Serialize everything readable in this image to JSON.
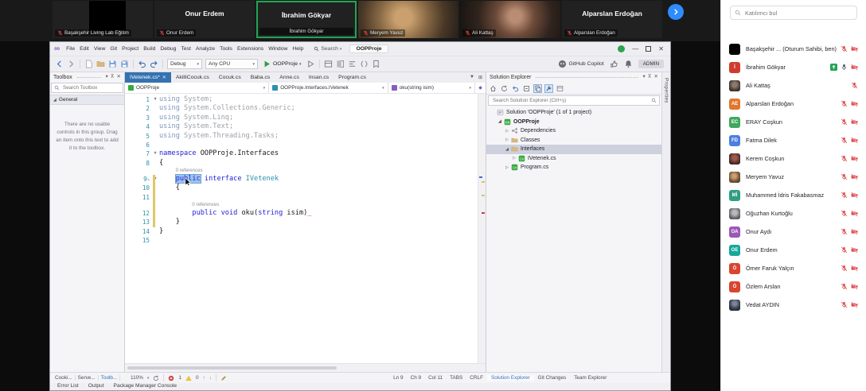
{
  "colors": {
    "accent_blue": "#3572b0",
    "zoom_blue": "#2e8cff",
    "active_speaker_green": "#23a455",
    "danger_red": "#e04444",
    "vs_purple": "#8a5bc0"
  },
  "meeting": {
    "search_placeholder": "Katılımcı bul",
    "tiles": [
      {
        "label": "Başakşehir Living Lab Eğitim",
        "style": "redacted",
        "muted": true
      },
      {
        "label": "Onur Erdem",
        "style": "name",
        "muted": true
      },
      {
        "label": "İbrahim Gökyar",
        "style": "name",
        "muted": false,
        "active": true
      },
      {
        "label": "Meryem Yavuz",
        "style": "photo-warm",
        "muted": true
      },
      {
        "label": "Ali Kattaş",
        "style": "photo-dark",
        "muted": true
      },
      {
        "label": "Alparslan Erdoğan",
        "style": "name",
        "muted": true
      }
    ],
    "participants": [
      {
        "name": "Başakşehir ... (Oturum Sahibi, ben)",
        "avatar_type": "black",
        "icons": [
          "mic-off",
          "cam-off"
        ]
      },
      {
        "name": "İbrahim Gökyar",
        "avatar_type": "initial",
        "initials": "İ",
        "avatar_color": "#cf3c2e",
        "icons": [
          "share",
          "mic-on",
          "cam-off"
        ]
      },
      {
        "name": "Ali Kattaş",
        "avatar_type": "photo-dark",
        "icons": [
          "mic-off"
        ]
      },
      {
        "name": "Alparslan Erdoğan",
        "avatar_type": "initial",
        "initials": "AE",
        "avatar_color": "#e2762c",
        "icons": [
          "mic-off",
          "cam-off"
        ]
      },
      {
        "name": "ERAY Coşkun",
        "avatar_type": "initial",
        "initials": "EC",
        "avatar_color": "#41a85f",
        "icons": [
          "mic-off",
          "cam-off"
        ]
      },
      {
        "name": "Fatma Dilek",
        "avatar_type": "initial",
        "initials": "FD",
        "avatar_color": "#4a7fe0",
        "icons": [
          "mic-off",
          "cam-off"
        ]
      },
      {
        "name": "Kerem Coşkun",
        "avatar_type": "photo-red",
        "icons": [
          "mic-off",
          "cam-off"
        ]
      },
      {
        "name": "Meryem Yavuz",
        "avatar_type": "photo-warm",
        "icons": [
          "mic-off",
          "cam-off"
        ]
      },
      {
        "name": "Muhammed İdris Fakabasmaz",
        "avatar_type": "initial",
        "initials": "Mİ",
        "avatar_color": "#2f9e82",
        "icons": [
          "mic-off",
          "cam-off"
        ]
      },
      {
        "name": "Oğuzhan Kurtoğlu",
        "avatar_type": "photo-gray",
        "icons": [
          "mic-off",
          "cam-off"
        ]
      },
      {
        "name": "Onur Aydı",
        "avatar_type": "initial",
        "initials": "OA",
        "avatar_color": "#9b59b6",
        "icons": [
          "mic-off",
          "cam-off"
        ]
      },
      {
        "name": "Onur Erdem",
        "avatar_type": "initial",
        "initials": "OE",
        "avatar_color": "#16a89a",
        "icons": [
          "mic-off",
          "cam-off"
        ]
      },
      {
        "name": "Ömer Faruk Yalçın",
        "avatar_type": "initial",
        "initials": "Ö",
        "avatar_color": "#d9452f",
        "icons": [
          "mic-off",
          "cam-off"
        ]
      },
      {
        "name": "Özlem Arslan",
        "avatar_type": "initial",
        "initials": "Ö",
        "avatar_color": "#d9452f",
        "icons": [
          "mic-off",
          "cam-off"
        ]
      },
      {
        "name": "Vedat AYDIN",
        "avatar_type": "photo-navy",
        "icons": [
          "mic-off",
          "cam-off"
        ]
      }
    ]
  },
  "vs": {
    "window_title": "OOPProje",
    "menu": [
      "File",
      "Edit",
      "View",
      "Git",
      "Project",
      "Build",
      "Debug",
      "Test",
      "Analyze",
      "Tools",
      "Extensions",
      "Window",
      "Help"
    ],
    "search_label": "Search",
    "toolbar": {
      "configuration": "Debug",
      "platform": "Any CPU",
      "run_target": "OOPProje",
      "copilot_label": "GitHub Copilot",
      "account_label": "ADMIN"
    },
    "toolbox": {
      "title": "Toolbox",
      "search_placeholder": "Search Toolbox",
      "section_label": "General",
      "empty_text": "There are no usable controls in this group. Drag an item onto this text to add it to the toolbox."
    },
    "editor": {
      "tabs": [
        {
          "label": "IVetenek.cs*",
          "active": true
        },
        {
          "label": "AkilliCocuk.cs"
        },
        {
          "label": "Cocuk.cs"
        },
        {
          "label": "Baba.cs"
        },
        {
          "label": "Anne.cs"
        },
        {
          "label": "Insan.cs"
        },
        {
          "label": "Program.cs"
        }
      ],
      "breadcrumbs": [
        {
          "label": "OOPProje",
          "icon": "project"
        },
        {
          "label": "OOPProje.Interfaces.IVetenek",
          "icon": "interface"
        },
        {
          "label": "oku(string isim)",
          "icon": "method"
        }
      ],
      "codelens_label": "0 references",
      "lines": [
        {
          "n": 1,
          "fold": "open",
          "tokens": [
            [
              "kwdim",
              "using"
            ],
            [
              "dim",
              " System;"
            ]
          ]
        },
        {
          "n": 2,
          "tokens": [
            [
              "kwdim",
              "using"
            ],
            [
              "dim",
              " System.Collections.Generic;"
            ]
          ]
        },
        {
          "n": 3,
          "tokens": [
            [
              "kwdim",
              "using"
            ],
            [
              "dim",
              " System.Linq;"
            ]
          ]
        },
        {
          "n": 4,
          "tokens": [
            [
              "kwdim",
              "using"
            ],
            [
              "dim",
              " System.Text;"
            ]
          ]
        },
        {
          "n": 5,
          "tokens": [
            [
              "kwdim",
              "using"
            ],
            [
              "dim",
              " System.Threading.Tasks;"
            ]
          ]
        },
        {
          "n": 6,
          "tokens": []
        },
        {
          "n": 7,
          "fold": "open",
          "tokens": [
            [
              "kw",
              "namespace"
            ],
            [
              "plain",
              " OOPProje.Interfaces"
            ]
          ]
        },
        {
          "n": 8,
          "tokens": [
            [
              "plain",
              "{"
            ]
          ]
        },
        {
          "lens": true,
          "indent": 4
        },
        {
          "n": 9,
          "fold": "open",
          "changed": true,
          "pen": true,
          "tokens": [
            [
              "plain",
              "    "
            ],
            [
              "kw sel",
              "public"
            ],
            [
              "kw",
              " interface "
            ],
            [
              "type",
              "IVetenek"
            ]
          ]
        },
        {
          "n": 10,
          "changed": true,
          "tokens": [
            [
              "plain",
              "    {"
            ]
          ]
        },
        {
          "n": 11,
          "changed": true,
          "tokens": []
        },
        {
          "lens": true,
          "indent": 8,
          "changed": true
        },
        {
          "n": 12,
          "changed": true,
          "tokens": [
            [
              "plain",
              "        "
            ],
            [
              "kw",
              "public"
            ],
            [
              "kw",
              " void "
            ],
            [
              "plain",
              "oku("
            ],
            [
              "kw",
              "string"
            ],
            [
              "plain",
              " isim)"
            ],
            [
              "err",
              "_"
            ]
          ]
        },
        {
          "n": 13,
          "changed": true,
          "tokens": [
            [
              "plain",
              "    }"
            ]
          ]
        },
        {
          "n": 14,
          "tokens": [
            [
              "plain",
              "}"
            ]
          ]
        },
        {
          "n": 15,
          "tokens": []
        }
      ]
    },
    "solution_explorer": {
      "title": "Solution Explorer",
      "search_placeholder": "Search Solution Explorer (Ctrl+ş)",
      "items": [
        {
          "label": "Solution 'OOPProje' (1 of 1 project)",
          "indent": 0,
          "icon": "solution"
        },
        {
          "label": "OOPProje",
          "indent": 1,
          "icon": "project",
          "expander": "open",
          "bold": true
        },
        {
          "label": "Dependencies",
          "indent": 2,
          "icon": "dependencies",
          "expander": "closed"
        },
        {
          "label": "Classes",
          "indent": 2,
          "icon": "folder",
          "expander": "closed"
        },
        {
          "label": "Interfaces",
          "indent": 2,
          "icon": "folder",
          "expander": "open",
          "selected": true
        },
        {
          "label": "IVetenek.cs",
          "indent": 3,
          "icon": "csfile",
          "expander": "closed"
        },
        {
          "label": "Program.cs",
          "indent": 2,
          "icon": "csfile",
          "expander": "closed"
        }
      ]
    },
    "properties_tab_label": "Properties",
    "status_bar": {
      "panel_tabs_left": [
        "Cooki...",
        "Serve...",
        "Toolb..."
      ],
      "active_left_tab": "Toolb...",
      "zoom_level": "110%",
      "error_count": "1",
      "warning_count": "0",
      "line": "Ln 9",
      "char": "Ch 9",
      "column": "Col 11",
      "indent_mode": "TABS",
      "line_ending": "CRLF",
      "panel_tabs_right": [
        "Solution Explorer",
        "Git Changes",
        "Team Explorer"
      ],
      "active_right_tab": "Solution Explorer",
      "bottom_tabs": [
        "Error List",
        "Output",
        "Package Manager Console"
      ]
    }
  }
}
